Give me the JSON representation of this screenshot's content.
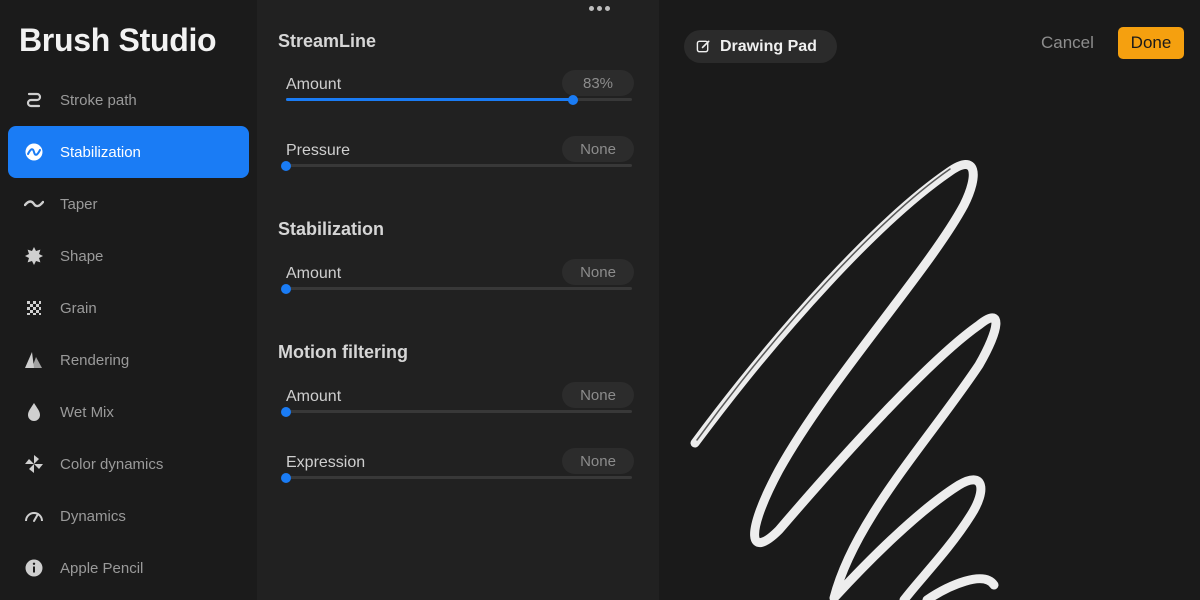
{
  "sidebar": {
    "title": "Brush Studio",
    "items": [
      {
        "label": "Stroke path",
        "icon": "stroke-path-icon",
        "active": false
      },
      {
        "label": "Stabilization",
        "icon": "stabilization-icon",
        "active": true
      },
      {
        "label": "Taper",
        "icon": "taper-icon",
        "active": false
      },
      {
        "label": "Shape",
        "icon": "shape-icon",
        "active": false
      },
      {
        "label": "Grain",
        "icon": "grain-icon",
        "active": false
      },
      {
        "label": "Rendering",
        "icon": "rendering-icon",
        "active": false
      },
      {
        "label": "Wet Mix",
        "icon": "wet-mix-icon",
        "active": false
      },
      {
        "label": "Color dynamics",
        "icon": "color-dynamics-icon",
        "active": false
      },
      {
        "label": "Dynamics",
        "icon": "dynamics-icon",
        "active": false
      },
      {
        "label": "Apple Pencil",
        "icon": "apple-pencil-icon",
        "active": false
      }
    ]
  },
  "panel": {
    "streamline": {
      "title": "StreamLine",
      "amount": {
        "label": "Amount",
        "value": "83%",
        "fraction": 0.83
      },
      "pressure": {
        "label": "Pressure",
        "value": "None",
        "fraction": 0
      }
    },
    "stabilization": {
      "title": "Stabilization",
      "amount": {
        "label": "Amount",
        "value": "None",
        "fraction": 0
      }
    },
    "motion_filtering": {
      "title": "Motion filtering",
      "amount": {
        "label": "Amount",
        "value": "None",
        "fraction": 0
      },
      "expression": {
        "label": "Expression",
        "value": "None",
        "fraction": 0
      }
    }
  },
  "canvas": {
    "pad_label": "Drawing Pad",
    "cancel_label": "Cancel",
    "done_label": "Done"
  },
  "colors": {
    "accent": "#1a7cf5",
    "done": "#f5a00f"
  }
}
